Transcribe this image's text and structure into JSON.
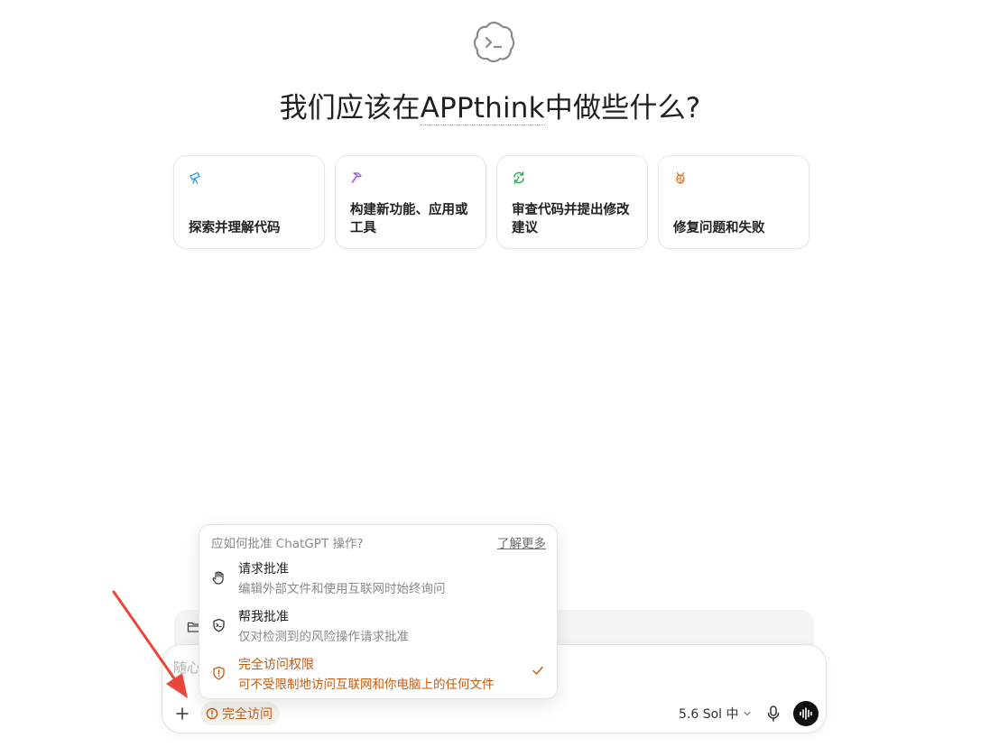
{
  "hero": {
    "title_prefix": "我们应该在",
    "project": "APPthink",
    "title_suffix": "中做些什么?"
  },
  "cards": [
    {
      "label": "探索并理解代码",
      "icon": "telescope-icon",
      "color": "#3b9bd6"
    },
    {
      "label": "构建新功能、应用或工具",
      "icon": "hammer-icon",
      "color": "#9b5fd6"
    },
    {
      "label": "审查代码并提出修改建议",
      "icon": "refresh-code-icon",
      "color": "#2fa85a"
    },
    {
      "label": "修复问题和失败",
      "icon": "bug-icon",
      "color": "#e0792a"
    }
  ],
  "composer": {
    "placeholder": "随心",
    "access_label": "完全访问",
    "model_label": "5.6 Sol 中",
    "accent": "#c75a12"
  },
  "popover": {
    "header": "应如何批准 ChatGPT 操作?",
    "learn_more": "了解更多",
    "options": [
      {
        "title": "请求批准",
        "desc": "编辑外部文件和使用互联网时始终询问",
        "icon": "hand-icon",
        "selected": false
      },
      {
        "title": "帮我批准",
        "desc": "仅对检测到的风险操作请求批准",
        "icon": "shield-code-icon",
        "selected": false
      },
      {
        "title": "完全访问权限",
        "desc": "可不受限制地访问互联网和你电脑上的任何文件",
        "icon": "shield-alert-icon",
        "selected": true
      }
    ]
  }
}
